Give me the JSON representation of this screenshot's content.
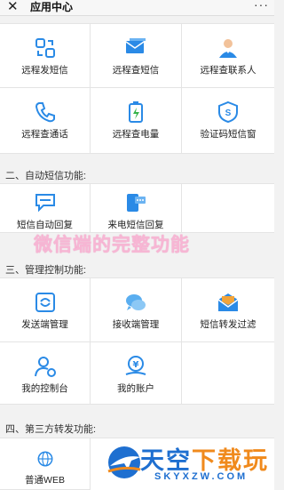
{
  "header": {
    "close_glyph": "✕",
    "title": "应用中心",
    "more_glyph": "···"
  },
  "grid1": [
    {
      "label": "远程发短信",
      "icon": "remote-send-sms-icon"
    },
    {
      "label": "远程查短信",
      "icon": "remote-check-sms-icon"
    },
    {
      "label": "远程查联系人",
      "icon": "remote-contacts-icon"
    },
    {
      "label": "远程查通话",
      "icon": "remote-calls-icon"
    },
    {
      "label": "远程查电量",
      "icon": "remote-battery-icon"
    },
    {
      "label": "验证码短信窗",
      "icon": "verification-sms-icon"
    }
  ],
  "section2": {
    "title": "二、自动短信功能:",
    "items": [
      {
        "label": "短信自动回复",
        "icon": "sms-auto-reply-icon"
      },
      {
        "label": "来电短信回复",
        "icon": "call-sms-reply-icon"
      },
      {
        "label": "",
        "icon": ""
      }
    ]
  },
  "section3": {
    "title": "三、管理控制功能:",
    "items": [
      {
        "label": "发送端管理",
        "icon": "sender-manage-icon"
      },
      {
        "label": "接收端管理",
        "icon": "receiver-manage-icon"
      },
      {
        "label": "短信转发过滤",
        "icon": "sms-forward-filter-icon"
      },
      {
        "label": "我的控制台",
        "icon": "my-console-icon"
      },
      {
        "label": "我的账户",
        "icon": "my-account-icon"
      },
      {
        "label": "",
        "icon": ""
      }
    ]
  },
  "section4": {
    "title": "四、第三方转发功能:",
    "items": [
      {
        "label": "普通WEB",
        "icon": "web-globe-icon"
      }
    ]
  },
  "watermark": "微信端的完整功能",
  "brand": {
    "name_part1": "天空",
    "name_part2": "下载玩",
    "domain": "SKYXZW.COM"
  },
  "colors": {
    "icon_blue": "#2a8ae6",
    "watermark_pink": "#f7b6d4",
    "brand_blue": "#1e6fd0",
    "brand_orange": "#f08a1c"
  }
}
